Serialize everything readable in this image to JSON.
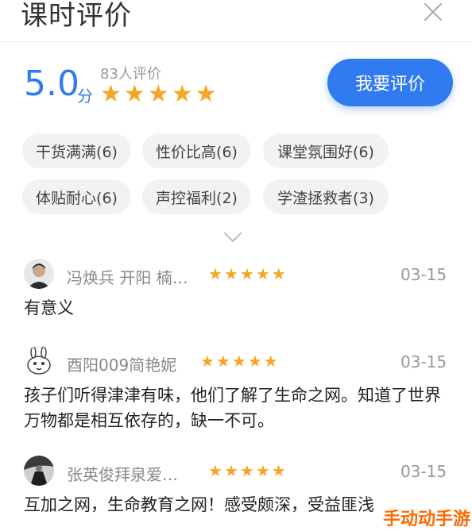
{
  "header": {
    "title": "课时评价"
  },
  "summary": {
    "score": "5.0",
    "unit": "分",
    "count": "83人评价",
    "stars": "★★★★★",
    "rate_button": "我要评价"
  },
  "tags": [
    "干货满满(6)",
    "性价比高(6)",
    "课堂氛围好(6)",
    "体贴耐心(6)",
    "声控福利(2)",
    "学渣拯救者(3)"
  ],
  "reviews": [
    {
      "name": "冯焕兵 开阳 楠…",
      "stars": "★★★★★",
      "date": "03-15",
      "text": "有意义"
    },
    {
      "name": "酉阳009简艳妮",
      "stars": "★★★★★",
      "date": "03-15",
      "text": "孩子们听得津津有味，他们了解了生命之网。知道了世界万物都是相互依存的，缺一不可。"
    },
    {
      "name": "张英俊拜泉爱…",
      "stars": "★★★★★",
      "date": "03-15",
      "text": "互加之网，生命教育之网！感受颇深，受益匪浅"
    }
  ],
  "watermark": "手动动手游",
  "colors": {
    "accent": "#2f7bef",
    "star": "#f5a623",
    "tag_bg": "#f1f2f4"
  }
}
